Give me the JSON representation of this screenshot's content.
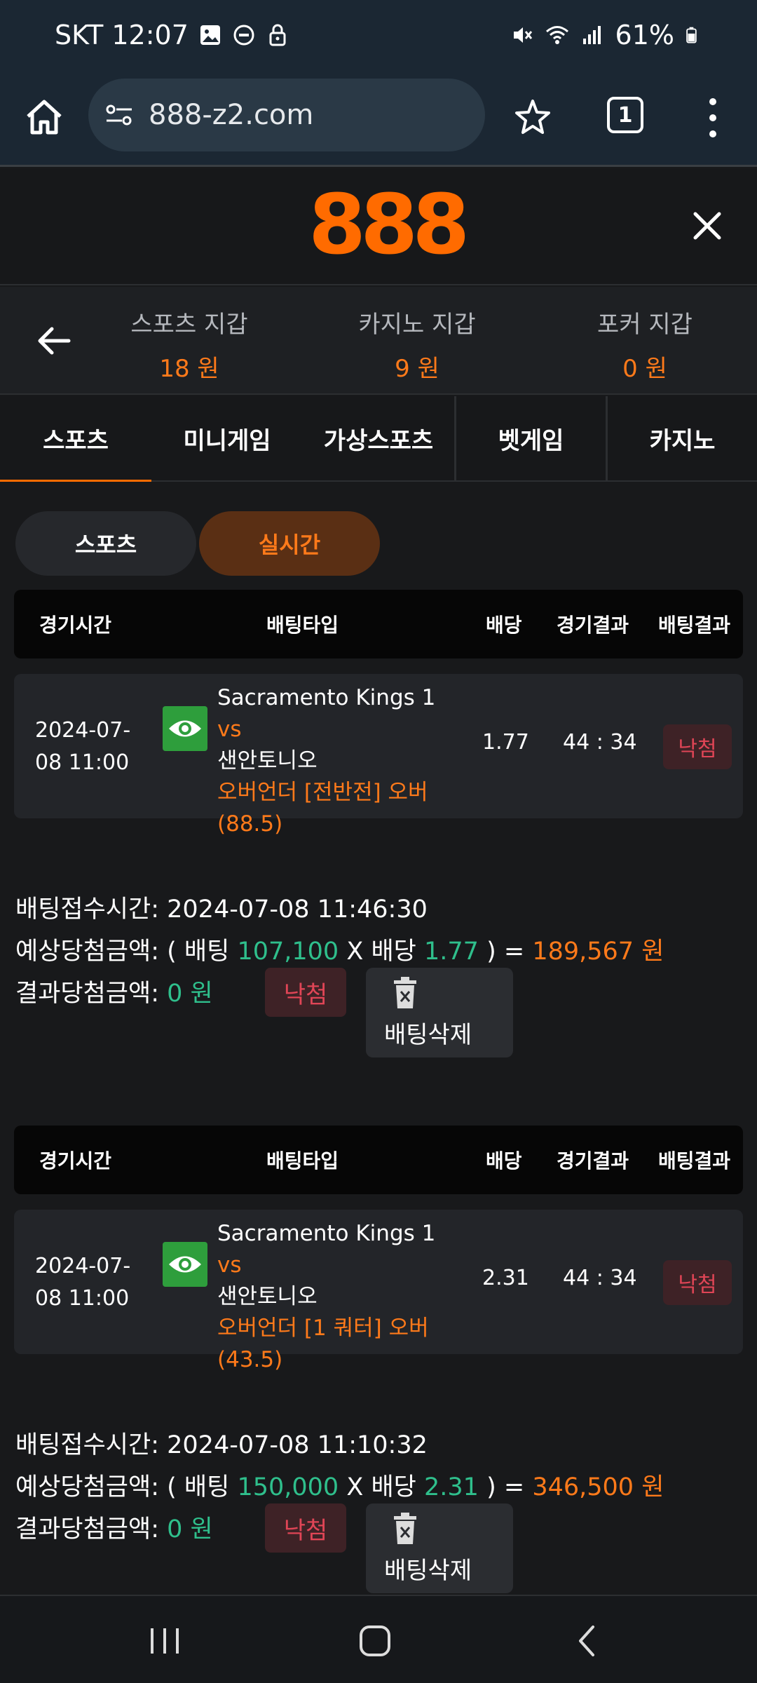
{
  "status_bar": {
    "carrier_time": "SKT 12:07",
    "battery": "61%"
  },
  "browser": {
    "url": "888-z2.com",
    "tab_count": "1"
  },
  "site": {
    "logo": "888"
  },
  "wallets": [
    {
      "label": "스포츠 지갑",
      "value": "18 원"
    },
    {
      "label": "카지노 지갑",
      "value": "9 원"
    },
    {
      "label": "포커 지갑",
      "value": "0 원"
    }
  ],
  "category_tabs": [
    "스포츠",
    "미니게임",
    "가상스포츠",
    "벳게임",
    "카지노"
  ],
  "sub_tabs": [
    "스포츠",
    "실시간"
  ],
  "table_headers": [
    "경기시간",
    "배팅타입",
    "배당",
    "경기결과",
    "배팅결과"
  ],
  "bets": [
    {
      "date_line1": "2024-07-",
      "date_line2": "08 11:00",
      "team_home": "Sacramento Kings 1",
      "vs": "vs",
      "team_away": "샌안토니오",
      "type_line1": "오버언더 [전반전] 오버",
      "type_line2": "(88.5)",
      "odds": "1.77",
      "score": "44 : 34",
      "result": "낙첨",
      "received_label": "배팅접수시간:",
      "received_time": "2024-07-08 11:46:30",
      "expected_label": "예상당첨금액:",
      "bet_word": "( 배팅",
      "bet_amount": "107,100",
      "odds_word": "X 배당",
      "odds_value": "1.77",
      "equals": ") =",
      "expected_amount": "189,567 원",
      "final_label": "결과당첨금액:",
      "final_amount": "0 원",
      "final_result": "낙첨",
      "delete_label": "배팅삭제"
    },
    {
      "date_line1": "2024-07-",
      "date_line2": "08 11:00",
      "team_home": "Sacramento Kings 1",
      "vs": "vs",
      "team_away": "샌안토니오",
      "type_line1": "오버언더 [1 쿼터] 오버",
      "type_line2": "(43.5)",
      "odds": "2.31",
      "score": "44 : 34",
      "result": "낙첨",
      "received_label": "배팅접수시간:",
      "received_time": "2024-07-08 11:10:32",
      "expected_label": "예상당첨금액:",
      "bet_word": "( 배팅",
      "bet_amount": "150,000",
      "odds_word": "X 배당",
      "odds_value": "2.31",
      "equals": ") =",
      "expected_amount": "346,500 원",
      "final_label": "결과당첨금액:",
      "final_amount": "0 원",
      "final_result": "낙첨",
      "delete_label": "배팅삭제"
    }
  ],
  "colors": {
    "accent": "#ff6b00",
    "green": "#2fbf8c",
    "lose": "#e04556"
  }
}
